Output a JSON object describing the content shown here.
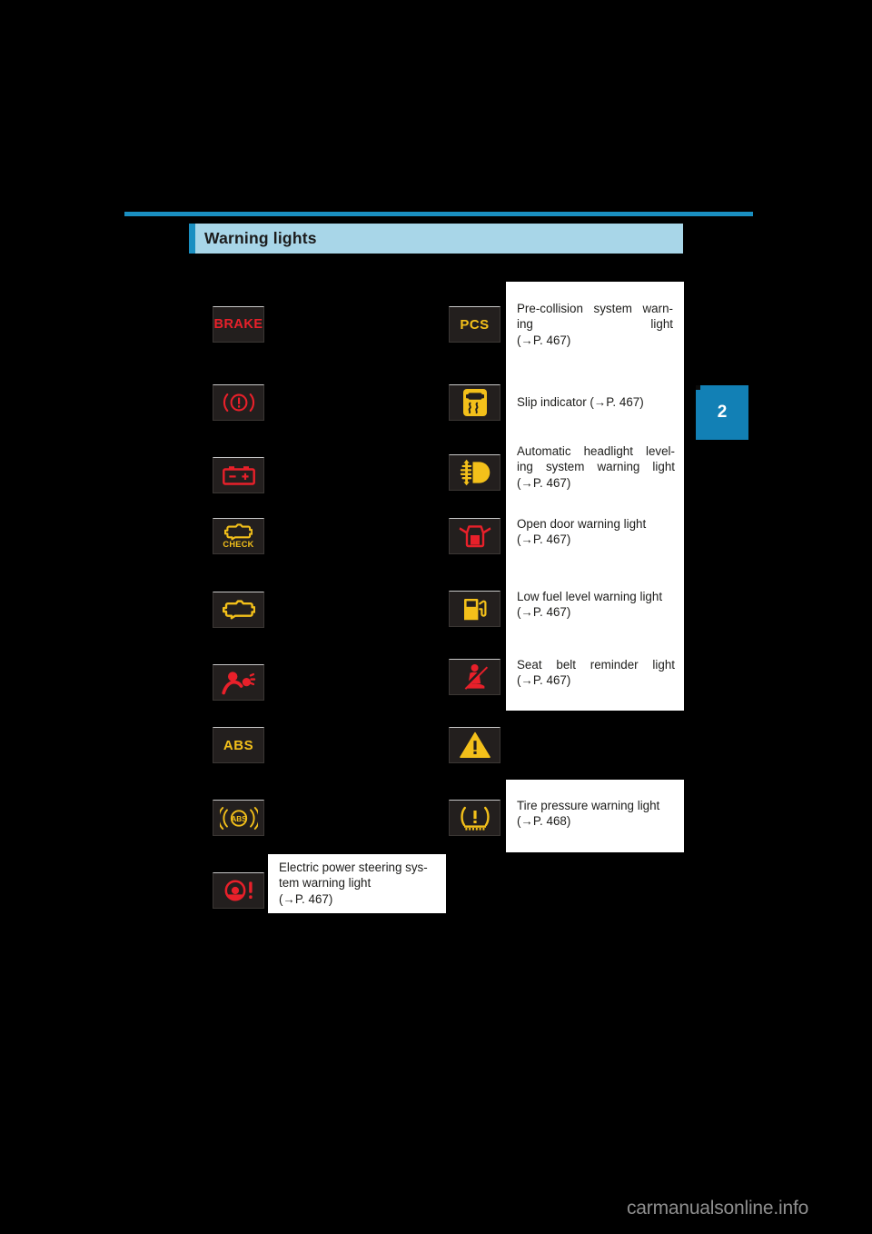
{
  "page": {
    "chapter_tab": "2",
    "footer_watermark": "carmanualsonline.info"
  },
  "section": {
    "title": "Warning lights"
  },
  "left_column": [
    {
      "icon": "brake-warning-light-icon",
      "label": "BRAKE",
      "color": "#e8202a"
    },
    {
      "icon": "brake-system-warning-light-icon",
      "label": "",
      "color": "#e8202a"
    },
    {
      "icon": "charging-system-warning-light-icon",
      "label": "",
      "color": "#e8202a"
    },
    {
      "icon": "check-engine-warning-light-icon",
      "label": "CHECK",
      "color": "#f3c01a"
    },
    {
      "icon": "malfunction-indicator-lamp-icon",
      "label": "",
      "color": "#f3c01a"
    },
    {
      "icon": "srs-airbag-warning-light-icon",
      "label": "",
      "color": "#e8202a"
    },
    {
      "icon": "abs-warning-light-icon",
      "label": "ABS",
      "color": "#f3c01a"
    },
    {
      "icon": "brake-assist-warning-light-icon",
      "label": "ABS",
      "color": "#f3c01a"
    },
    {
      "icon": "electric-power-steering-warning-light-icon",
      "label": "",
      "color": "#e8202a"
    }
  ],
  "right_column": [
    {
      "icon": "pcs-warning-light-icon",
      "label": "PCS",
      "color": "#f3c01a"
    },
    {
      "icon": "slip-indicator-icon",
      "label": "",
      "color": "#f3c01a"
    },
    {
      "icon": "auto-headlight-leveling-warning-light-icon",
      "label": "",
      "color": "#f3c01a"
    },
    {
      "icon": "open-door-warning-light-icon",
      "label": "",
      "color": "#e8202a"
    },
    {
      "icon": "low-fuel-level-warning-light-icon",
      "label": "",
      "color": "#f3c01a"
    },
    {
      "icon": "seat-belt-reminder-light-icon",
      "label": "",
      "color": "#e8202a"
    },
    {
      "icon": "master-warning-light-icon",
      "label": "",
      "color": "#f3c01a"
    },
    {
      "icon": "tire-pressure-warning-light-icon",
      "label": "",
      "color": "#f3c01a"
    }
  ],
  "descriptions": {
    "pre_collision": "Pre-collision system warn-\ning light\n(→P. 467)",
    "slip_indicator": "Slip indicator (→P. 467)",
    "headlight_leveling": "Automatic headlight level-\ning system warning light\n(→P. 467)",
    "open_door": "Open door warning light\n(→P. 467)",
    "low_fuel": "Low fuel level warning light\n(→P. 467)",
    "seat_belt": "Seat belt reminder light\n(→P. 467)",
    "tire_pressure": "Tire pressure warning light\n(→P. 468)",
    "electric_power_steering": "Electric power steering sys-\ntem warning light\n(→P. 467)"
  },
  "colors": {
    "accent_blue": "#1a8fc1",
    "bar_light_blue": "#a8d6e8",
    "tab_blue": "#1280b5",
    "warning_red": "#e8202a",
    "warning_amber": "#f3c01a",
    "tile_background": "#231f1e",
    "page_background": "#000000"
  }
}
